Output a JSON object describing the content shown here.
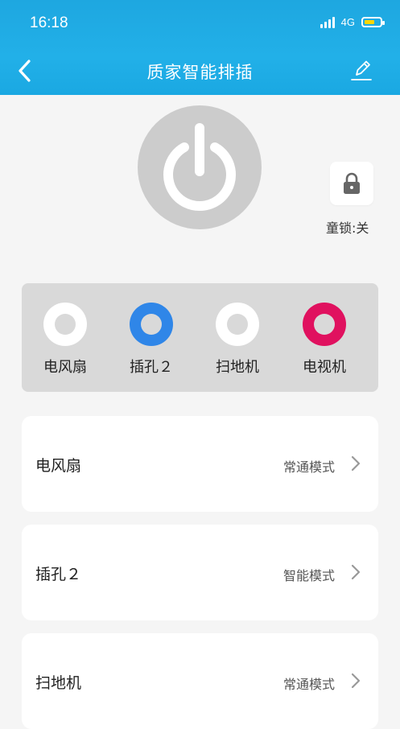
{
  "status_bar": {
    "time": "16:18",
    "network": "4G"
  },
  "nav": {
    "title": "质家智能排插"
  },
  "child_lock": {
    "label": "童锁:关"
  },
  "sockets": [
    {
      "label": "电风扇",
      "color": "#ffffff"
    },
    {
      "label": "插孔２",
      "color": "#2f86e8"
    },
    {
      "label": "扫地机",
      "color": "#ffffff"
    },
    {
      "label": "电视机",
      "color": "#e0115f"
    }
  ],
  "outlets": [
    {
      "name": "电风扇",
      "mode": "常通模式"
    },
    {
      "name": "插孔２",
      "mode": "智能模式"
    },
    {
      "name": "扫地机",
      "mode": "常通模式"
    }
  ],
  "colors": {
    "header": "#1ea7e0",
    "power_button": "#cccccc",
    "panel": "#d9d9d9"
  }
}
